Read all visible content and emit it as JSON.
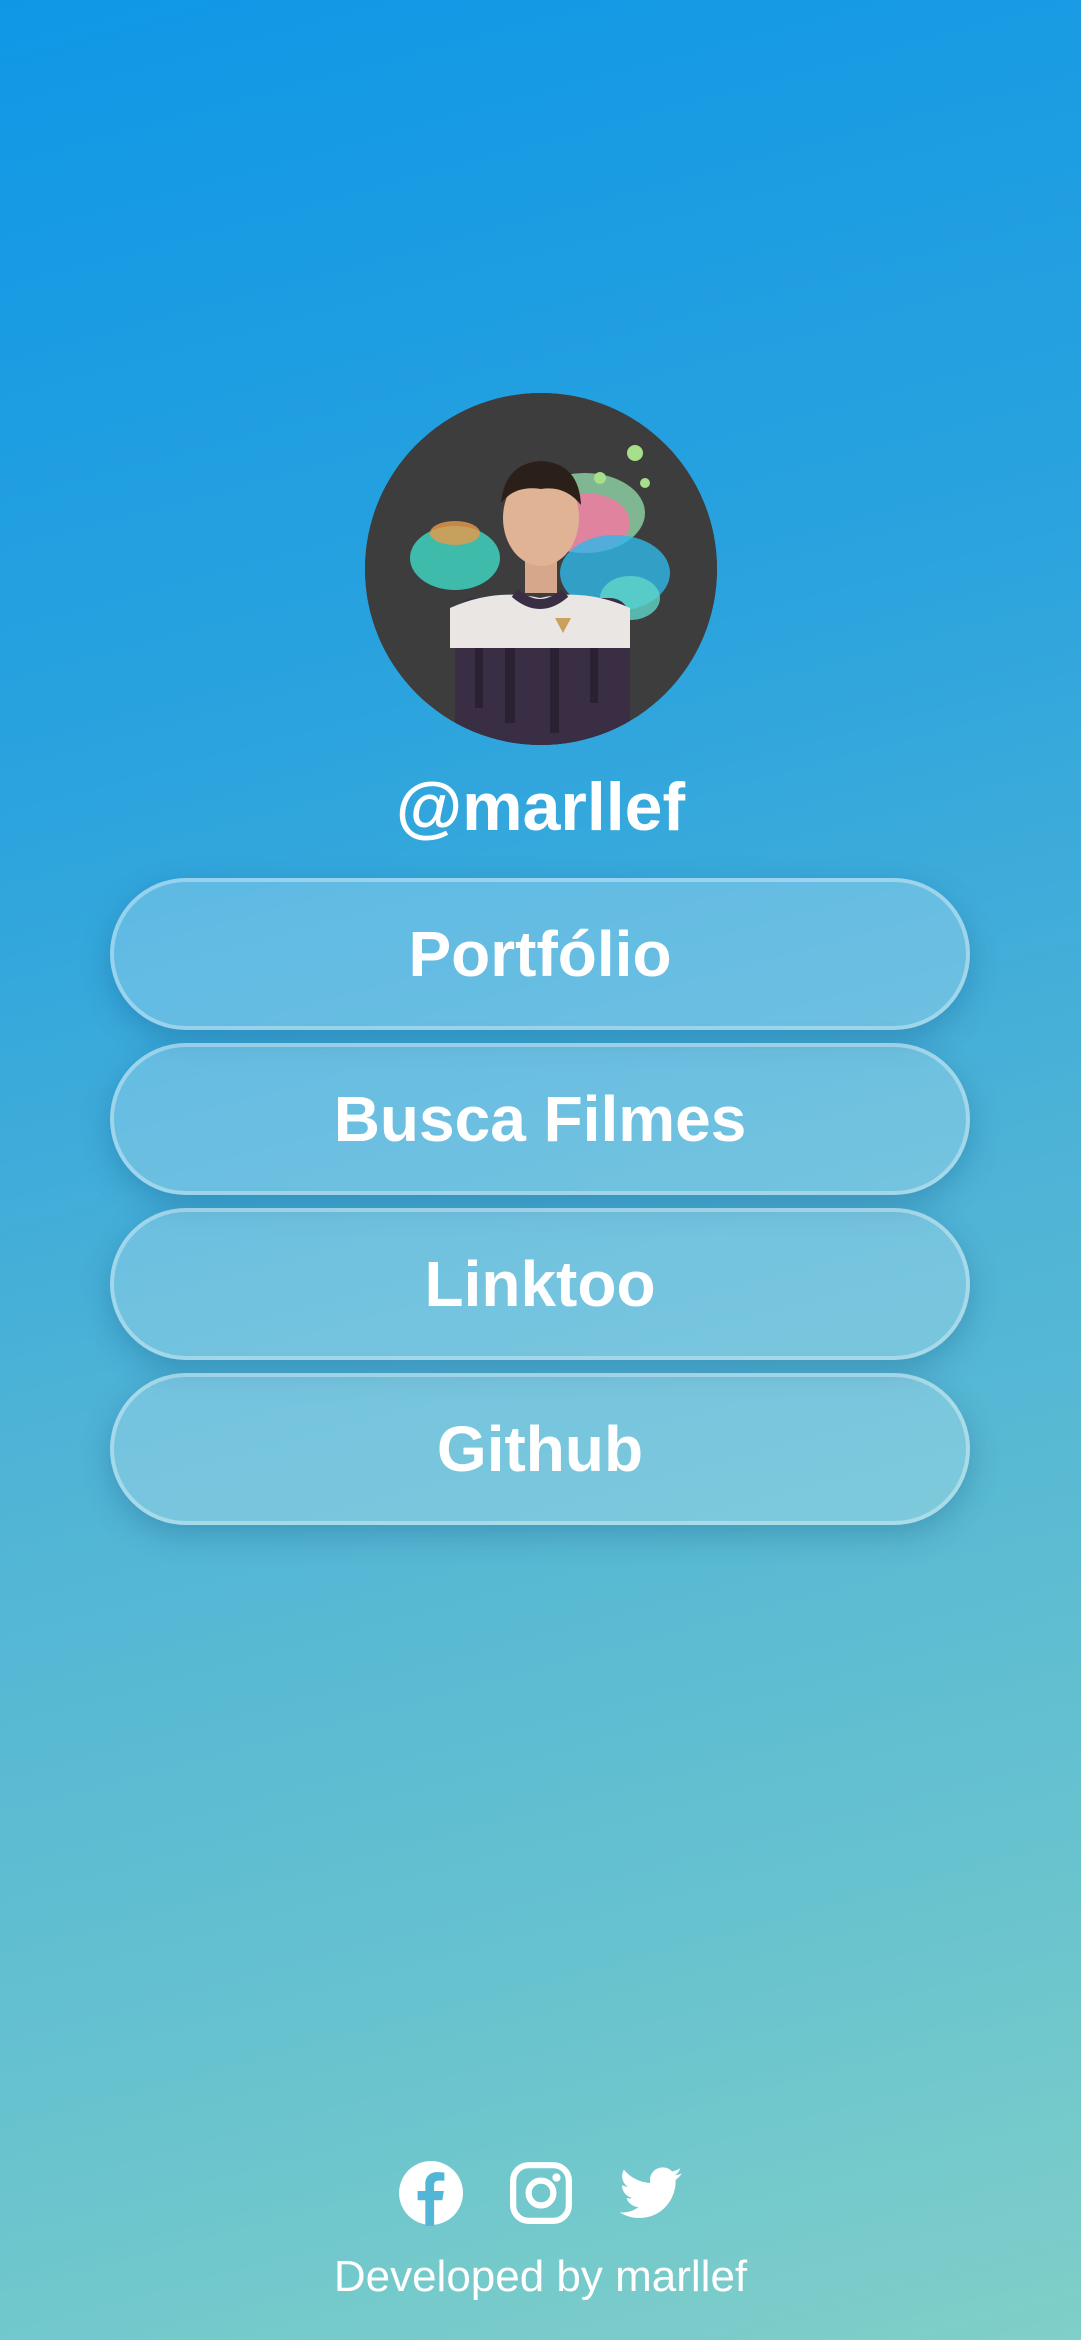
{
  "profile": {
    "username": "@marllef"
  },
  "links": [
    {
      "label": "Portfólio"
    },
    {
      "label": "Busca Filmes"
    },
    {
      "label": "Linktoo"
    },
    {
      "label": "Github"
    }
  ],
  "social": [
    {
      "icon": "facebook-icon"
    },
    {
      "icon": "instagram-icon"
    },
    {
      "icon": "twitter-icon"
    }
  ],
  "footer": {
    "credit": "Developed by marllef"
  },
  "colors": {
    "gradient_top": "#0f97e6",
    "gradient_bottom": "#80cfc8",
    "avatar_bg": "#3d3d3d",
    "text": "#ffffff"
  }
}
